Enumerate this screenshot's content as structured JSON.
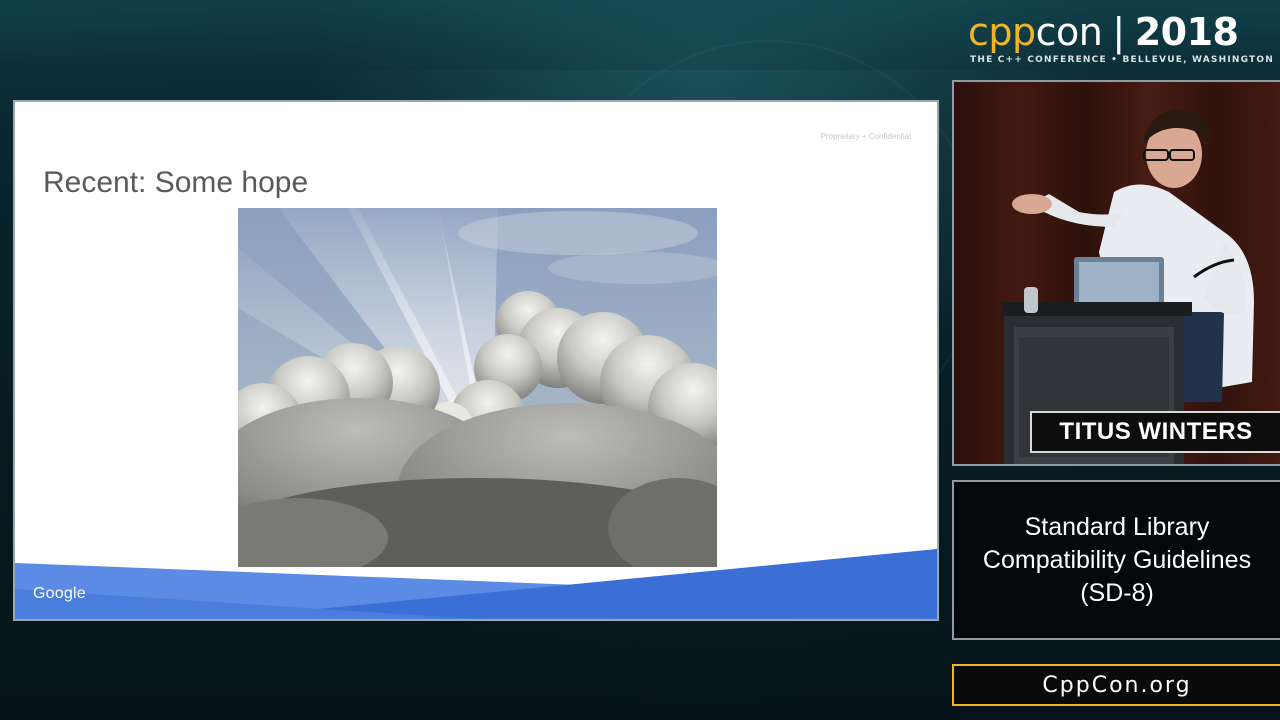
{
  "slide": {
    "confidential_label": "Proprietary + Confidential",
    "title": "Recent: Some hope",
    "footer_brand": "Google",
    "footer_color": "#3b6fd6",
    "image_alt": "sun rays breaking through clouds"
  },
  "branding": {
    "logo_cpp": "cpp",
    "logo_con": "con",
    "logo_separator": "|",
    "logo_year": "2018",
    "tagline": "THE C++ CONFERENCE • BELLEVUE, WASHINGTON",
    "accent_color": "#f0b523"
  },
  "speaker": {
    "name": "TITUS WINTERS"
  },
  "talk": {
    "title": "Standard Library Compatibility Guidelines (SD-8)"
  },
  "site": {
    "url": "CppCon.org"
  }
}
